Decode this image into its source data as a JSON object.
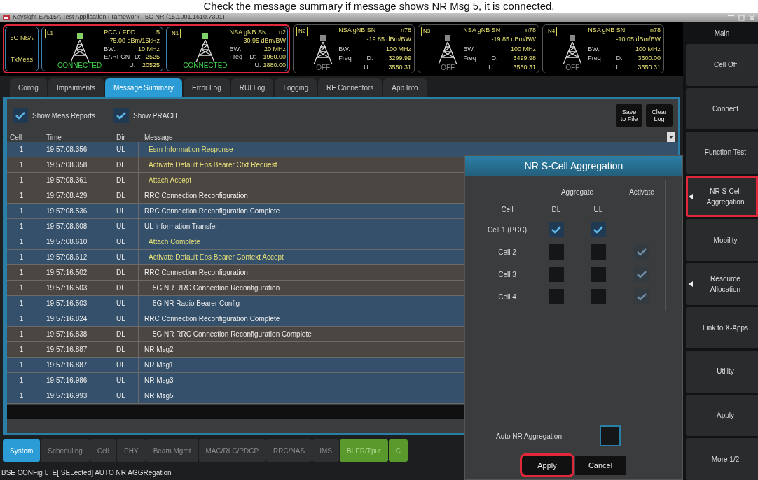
{
  "caption": "Check the message summary if message shows NR Msg 5, it is connected.",
  "window": {
    "title": "Keysight E7515A Test Application Framework - 5G NR (15.1001.1610.7301)"
  },
  "status_box": {
    "mode": "5G NSA",
    "test": "TxMeas",
    "highlighted": true
  },
  "cells": [
    {
      "tag": "L1",
      "title": "PCC / FDD",
      "band": "5",
      "power": "-75.00 dBm/15kHz",
      "bw_label": "BW:",
      "bw": "10 MHz",
      "freq_label": "EARFCN",
      "dl_label": "D:",
      "dl": "2525",
      "ul_label": "U:",
      "ul": "20525",
      "state": "CONNECTED",
      "connected": true,
      "highlighted": true
    },
    {
      "tag": "N1",
      "title": "NSA gNB SN",
      "band": "n2",
      "power": "-30.95 dBm/BW",
      "bw_label": "BW:",
      "bw": "20 MHz",
      "freq_label": "Freq",
      "dl_label": "D:",
      "dl": "1960.00",
      "ul_label": "U:",
      "ul": "1880.00",
      "state": "CONNECTED",
      "connected": true,
      "highlighted": true
    },
    {
      "tag": "N2",
      "title": "NSA gNB SN",
      "band": "n78",
      "power": "-19.85 dBm/BW",
      "bw_label": "BW:",
      "bw": "100 MHz",
      "freq_label": "Freq",
      "dl_label": "D:",
      "dl": "3299.99",
      "ul_label": "U:",
      "ul": "3550.31",
      "state": "OFF",
      "connected": false,
      "highlighted": false
    },
    {
      "tag": "N3",
      "title": "NSA gNB SN",
      "band": "n78",
      "power": "-19.85 dBm/BW",
      "bw_label": "BW:",
      "bw": "100 MHz",
      "freq_label": "Freq",
      "dl_label": "D:",
      "dl": "3499.98",
      "ul_label": "U:",
      "ul": "3550.31",
      "state": "OFF",
      "connected": false,
      "highlighted": false
    },
    {
      "tag": "N4",
      "title": "NSA gNB SN",
      "band": "n78",
      "power": "-10.05 dBm/BW",
      "bw_label": "BW:",
      "bw": "100 MHz",
      "freq_label": "Freq",
      "dl_label": "D:",
      "dl": "3600.00",
      "ul_label": "U:",
      "ul": "3550.31",
      "state": "OFF",
      "connected": false,
      "highlighted": false
    }
  ],
  "tabs": [
    {
      "label": "Config",
      "selected": false
    },
    {
      "label": "Impairments",
      "selected": false
    },
    {
      "label": "Message Summary",
      "selected": true
    },
    {
      "label": "Error Log",
      "selected": false
    },
    {
      "label": "RUI Log",
      "selected": false
    },
    {
      "label": "Logging",
      "selected": false
    },
    {
      "label": "RF Connectors",
      "selected": false
    },
    {
      "label": "App Info",
      "selected": false
    }
  ],
  "options": [
    {
      "label": "Show Meas Reports",
      "checked": true
    },
    {
      "label": "Show PRACH",
      "checked": true
    }
  ],
  "log_buttons": [
    "Save to File",
    "Clear Log"
  ],
  "table": {
    "columns": [
      "Cell",
      "Time",
      "Dir",
      "Message"
    ],
    "rows": [
      {
        "cell": "1",
        "time": "19:57:08.356",
        "dir": "UL",
        "uplink": true,
        "message": "Esm Information Response",
        "kind": "nas"
      },
      {
        "cell": "1",
        "time": "19:57:08.358",
        "dir": "DL",
        "uplink": false,
        "message": "Activate Default Eps Bearer Ctxt Request",
        "kind": "nas"
      },
      {
        "cell": "1",
        "time": "19:57:08.361",
        "dir": "DL",
        "uplink": false,
        "message": "Attach Accept",
        "kind": "nas"
      },
      {
        "cell": "1",
        "time": "19:57:08.429",
        "dir": "DL",
        "uplink": false,
        "message": "RRC Connection Reconfiguration",
        "kind": "rrc"
      },
      {
        "cell": "1",
        "time": "19:57:08.536",
        "dir": "UL",
        "uplink": true,
        "message": "RRC Connection Reconfiguration Complete",
        "kind": "rrc"
      },
      {
        "cell": "1",
        "time": "19:57:08.608",
        "dir": "UL",
        "uplink": true,
        "message": "UL Information Transfer",
        "kind": "rrc"
      },
      {
        "cell": "1",
        "time": "19:57:08.610",
        "dir": "UL",
        "uplink": true,
        "message": "Attach Complete",
        "kind": "nas"
      },
      {
        "cell": "1",
        "time": "19:57:08.612",
        "dir": "UL",
        "uplink": true,
        "message": "Activate Default Eps Bearer Context Accept",
        "kind": "nas"
      },
      {
        "cell": "1",
        "time": "19:57:16.502",
        "dir": "DL",
        "uplink": false,
        "message": "RRC Connection Reconfiguration",
        "kind": "rrc"
      },
      {
        "cell": "1",
        "time": "19:57:16.503",
        "dir": "DL",
        "uplink": false,
        "message": "5G NR RRC Connection Reconfiguration",
        "kind": "nr"
      },
      {
        "cell": "1",
        "time": "19:57:16.503",
        "dir": "UL",
        "uplink": true,
        "message": "5G NR Radio Bearer Config",
        "kind": "nr"
      },
      {
        "cell": "1",
        "time": "19:57:16.824",
        "dir": "UL",
        "uplink": true,
        "message": "RRC Connection Reconfiguration Complete",
        "kind": "rrc"
      },
      {
        "cell": "1",
        "time": "19:57:16.838",
        "dir": "DL",
        "uplink": false,
        "message": "5G NR RRC Connection Reconfiguration Complete",
        "kind": "nr"
      },
      {
        "cell": "1",
        "time": "19:57:16.887",
        "dir": "DL",
        "uplink": false,
        "message": "NR Msg2",
        "kind": "rrc"
      },
      {
        "cell": "1",
        "time": "19:57:16.887",
        "dir": "UL",
        "uplink": true,
        "message": "NR Msg1",
        "kind": "rrc"
      },
      {
        "cell": "1",
        "time": "19:57:16.986",
        "dir": "UL",
        "uplink": true,
        "message": "NR Msg3",
        "kind": "rrc"
      },
      {
        "cell": "1",
        "time": "19:57:16.993",
        "dir": "UL",
        "uplink": true,
        "message": "NR Msg5",
        "kind": "rrc"
      }
    ]
  },
  "bottom_tabs": [
    {
      "label": "System",
      "selected": true,
      "kind": "plain"
    },
    {
      "label": "Scheduling",
      "selected": false,
      "kind": "plain"
    },
    {
      "label": "Cell",
      "selected": false,
      "kind": "plain"
    },
    {
      "label": "PHY",
      "selected": false,
      "kind": "plain"
    },
    {
      "label": "Beam Mgmt",
      "selected": false,
      "kind": "plain"
    },
    {
      "label": "MAC/RLC/PDCP",
      "selected": false,
      "kind": "plain"
    },
    {
      "label": "RRC/NAS",
      "selected": false,
      "kind": "plain"
    },
    {
      "label": "IMS",
      "selected": false,
      "kind": "plain"
    },
    {
      "label": "BLER/Tput",
      "selected": false,
      "kind": "green"
    },
    {
      "label": "C",
      "selected": false,
      "kind": "green"
    }
  ],
  "status_bar": "BSE CONFig LTE[ SELected] AUTO NR AGGRegation",
  "dialog": {
    "title": "NR S-Cell Aggregation",
    "group_aggregate": "Aggregate",
    "group_activate": "Activate",
    "col_cell": "Cell",
    "col_dl": "DL",
    "col_ul": "UL",
    "rows": [
      {
        "cell": "Cell 1 (PCC)",
        "dl": true,
        "ul": true,
        "activate": null
      },
      {
        "cell": "Cell 2",
        "dl": false,
        "ul": false,
        "activate": {
          "checked": true,
          "disabled": true
        }
      },
      {
        "cell": "Cell 3",
        "dl": false,
        "ul": false,
        "activate": {
          "checked": true,
          "disabled": true
        }
      },
      {
        "cell": "Cell 4",
        "dl": false,
        "ul": false,
        "activate": {
          "checked": true,
          "disabled": true
        }
      }
    ],
    "auto": {
      "label": "Auto NR Aggregation",
      "checked": false
    },
    "buttons": [
      {
        "label": "Apply",
        "highlighted": true
      },
      {
        "label": "Cancel",
        "highlighted": false
      }
    ]
  },
  "side_panel": {
    "title": "Main",
    "buttons": [
      {
        "label": "Cell Off",
        "submenu": false,
        "highlighted": false
      },
      {
        "label": "Connect",
        "submenu": false,
        "highlighted": false
      },
      {
        "label": "Function Test",
        "submenu": false,
        "highlighted": false
      },
      {
        "label": "NR S-Cell Aggregation",
        "submenu": true,
        "highlighted": true
      },
      {
        "label": "Mobility",
        "submenu": false,
        "highlighted": false
      },
      {
        "label": "Resource Allocation",
        "submenu": true,
        "highlighted": false
      },
      {
        "label": "Link to X-Apps",
        "submenu": false,
        "highlighted": false
      },
      {
        "label": "Utility",
        "submenu": false,
        "highlighted": false
      },
      {
        "label": "Apply",
        "submenu": false,
        "highlighted": false
      },
      {
        "label": "More 1/2",
        "submenu": false,
        "highlighted": false
      }
    ]
  }
}
